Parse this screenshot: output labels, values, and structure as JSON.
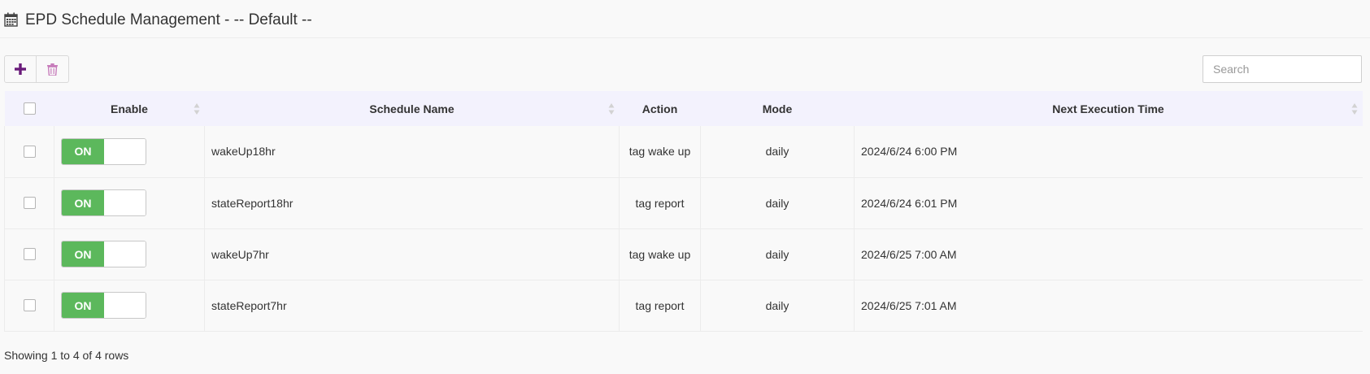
{
  "header": {
    "icon": "calendar-icon",
    "title": "EPD Schedule Management - -- Default --"
  },
  "toolbar": {
    "add_icon": "plus-icon",
    "delete_icon": "trash-icon",
    "accent_color": "#6a1b7a",
    "delete_color": "#c77dbb"
  },
  "search": {
    "placeholder": "Search",
    "value": ""
  },
  "table": {
    "columns": {
      "enable": "Enable",
      "schedule_name": "Schedule Name",
      "action": "Action",
      "mode": "Mode",
      "next_execution_time": "Next Execution Time"
    },
    "rows": [
      {
        "enabled": "ON",
        "name": "wakeUp18hr",
        "action": "tag wake up",
        "mode": "daily",
        "next": "2024/6/24 6:00 PM"
      },
      {
        "enabled": "ON",
        "name": "stateReport18hr",
        "action": "tag report",
        "mode": "daily",
        "next": "2024/6/24 6:01 PM"
      },
      {
        "enabled": "ON",
        "name": "wakeUp7hr",
        "action": "tag wake up",
        "mode": "daily",
        "next": "2024/6/25 7:00 AM"
      },
      {
        "enabled": "ON",
        "name": "stateReport7hr",
        "action": "tag report",
        "mode": "daily",
        "next": "2024/6/25 7:01 AM"
      }
    ],
    "toggle_on_color": "#5cb85c",
    "header_bg": "#f3f2fd"
  },
  "footer": {
    "summary": "Showing 1 to 4 of 4 rows"
  }
}
